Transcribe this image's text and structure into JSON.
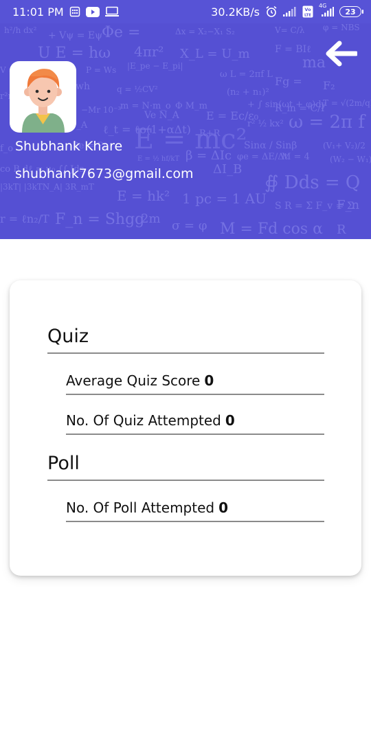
{
  "status_bar": {
    "time": "11:01 PM",
    "network_speed": "30.2KB/s",
    "battery": "23",
    "network_type": "4G",
    "volte": "Vo LTE",
    "left_icons": [
      "sim-card-icon",
      "youtube-icon",
      "cast-icon"
    ],
    "right_icons": [
      "alarm-icon",
      "signal-icon",
      "volte-icon",
      "signal-4g-icon",
      "battery-icon"
    ]
  },
  "header": {
    "background_color": "#5550d3",
    "back_icon": "arrow-back-icon",
    "avatar_icon": "user-avatar-icon",
    "user_name": "Shubhank Khare",
    "user_email": "shubhank7673@gmail.com"
  },
  "stats": {
    "quiz": {
      "title": "Quiz",
      "rows": [
        {
          "label": "Average Quiz Score",
          "value": "0"
        },
        {
          "label": "No. Of Quiz Attempted",
          "value": "0"
        }
      ]
    },
    "poll": {
      "title": "Poll",
      "rows": [
        {
          "label": "No. Of Poll Attempted",
          "value": "0"
        }
      ]
    }
  }
}
